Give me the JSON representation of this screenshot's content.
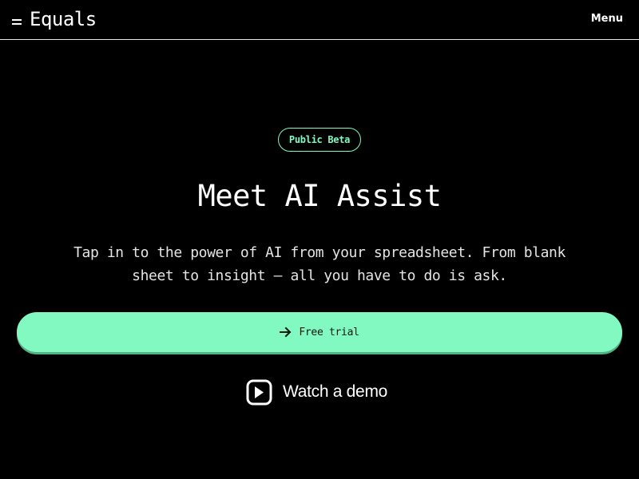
{
  "header": {
    "logo_text": "Equals",
    "menu_label": "Menu"
  },
  "hero": {
    "badge": "Public Beta",
    "title": "Meet AI Assist",
    "subtitle": "Tap in to the power of AI from your spreadsheet. From blank sheet to insight — all you have to do is ask.",
    "cta_label": "Free trial",
    "demo_label": "Watch a demo"
  },
  "icons": {
    "logo": "equals-icon",
    "cta": "arrow-right-icon",
    "demo": "play-icon"
  },
  "colors": {
    "background": "#000000",
    "accent": "#82f9c0",
    "text": "#ffffff"
  }
}
